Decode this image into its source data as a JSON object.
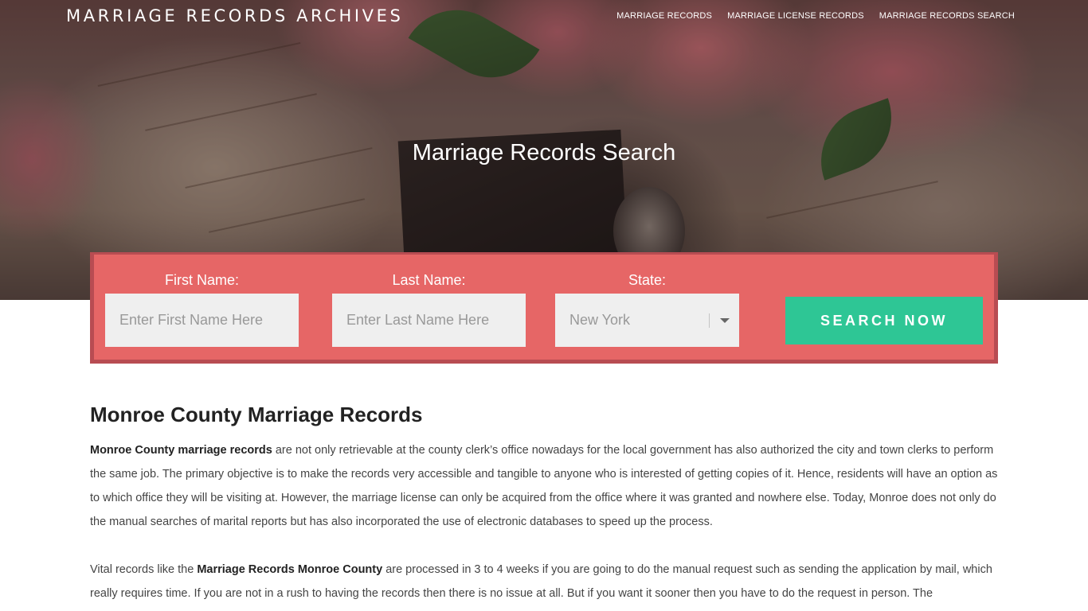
{
  "header": {
    "brand": "MARRIAGE RECORDS ARCHIVES",
    "nav": [
      {
        "label": "MARRIAGE RECORDS"
      },
      {
        "label": "MARRIAGE LICENSE RECORDS"
      },
      {
        "label": "MARRIAGE RECORDS SEARCH"
      }
    ]
  },
  "hero": {
    "title": "Marriage Records Search"
  },
  "search": {
    "first_name_label": "First Name:",
    "first_name_placeholder": "Enter First Name Here",
    "last_name_label": "Last Name:",
    "last_name_placeholder": "Enter Last Name Here",
    "state_label": "State:",
    "state_value": "New York",
    "button_label": "SEARCH NOW"
  },
  "article": {
    "heading": "Monroe County Marriage Records",
    "p1_bold": "Monroe County marriage records",
    "p1_rest": " are not only retrievable at the county clerk’s office nowadays for the local government has also authorized the city and town clerks to perform the same job. The primary objective is to make the records very accessible and tangible to anyone who is interested of getting copies of it. Hence, residents will have an option as to which office they will be visiting at. However, the marriage license can only be acquired from the office where it was granted and nowhere else. Today, Monroe does not only do the manual searches of marital reports but has also incorporated the use of electronic databases to speed up the process.",
    "p2_pre": "Vital records like the ",
    "p2_bold": "Marriage Records Monroe County",
    "p2_rest": " are processed in 3 to 4 weeks if you are going to do the manual request such as sending the application by mail, which really requires time. If you are not in a rush to having the records then there is no issue at all. But if you want it sooner then you have to do the request in person. The"
  },
  "colors": {
    "panel": "#e66666",
    "panel_border": "#b84c52",
    "button": "#2ec695",
    "input_bg": "#efefef"
  }
}
